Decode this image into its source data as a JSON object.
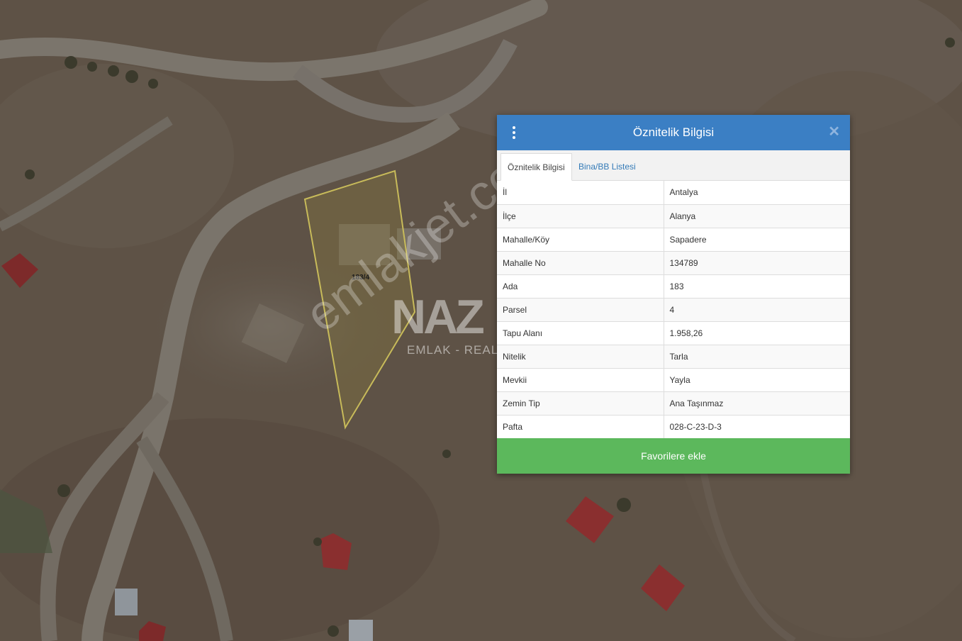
{
  "map": {
    "parcel_label": "183/4",
    "watermark_brand": "NAZ",
    "watermark_sub": "EMLAK - REAL",
    "watermark_site": "emlakjet.com"
  },
  "panel": {
    "title": "Öznitelik Bilgisi",
    "close_symbol": "✕",
    "tabs": [
      {
        "label": "Öznitelik Bilgisi",
        "active": true
      },
      {
        "label": "Bina/BB Listesi",
        "active": false
      }
    ],
    "rows": [
      {
        "key": "İl",
        "value": "Antalya"
      },
      {
        "key": "İlçe",
        "value": "Alanya"
      },
      {
        "key": "Mahalle/Köy",
        "value": "Sapadere"
      },
      {
        "key": "Mahalle No",
        "value": "134789"
      },
      {
        "key": "Ada",
        "value": "183"
      },
      {
        "key": "Parsel",
        "value": "4"
      },
      {
        "key": "Tapu Alanı",
        "value": "1.958,26"
      },
      {
        "key": "Nitelik",
        "value": "Tarla"
      },
      {
        "key": "Mevkii",
        "value": "Yayla"
      },
      {
        "key": "Zemin Tip",
        "value": "Ana Taşınmaz"
      },
      {
        "key": "Pafta",
        "value": "028-C-23-D-3"
      }
    ],
    "favorite_button": "Favorilere ekle"
  },
  "colors": {
    "header": "#3b7fc4",
    "favorite": "#5cb85c",
    "parcel_outline": "#c8bb5a"
  }
}
